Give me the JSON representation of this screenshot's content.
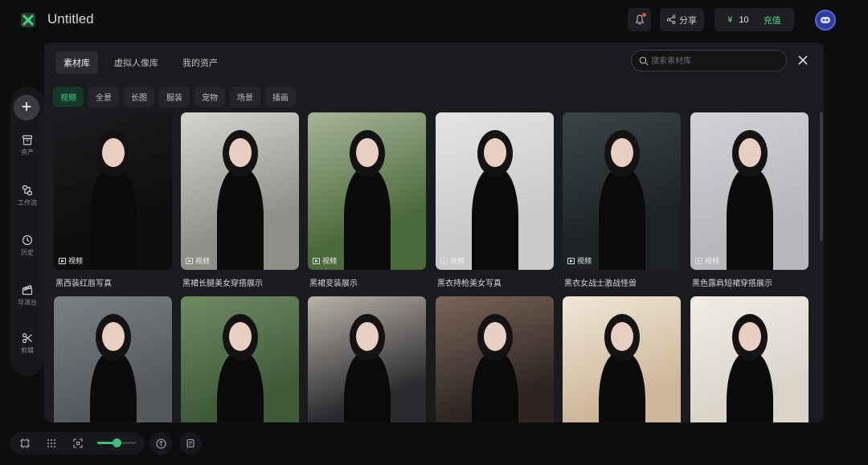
{
  "app": {
    "title": "Untitled"
  },
  "header": {
    "share_label": "分享",
    "credits_symbol": "¥",
    "credits_value": "10",
    "recharge_label": "充值"
  },
  "sidebar": {
    "add_label": "+",
    "items": [
      {
        "label": "资产",
        "icon": "archive-icon"
      },
      {
        "label": "工作流",
        "icon": "workflow-icon"
      },
      {
        "label": "历史",
        "icon": "clock-icon"
      },
      {
        "label": "导演台",
        "icon": "clapperboard-icon"
      },
      {
        "label": "剪辑",
        "icon": "scissors-icon"
      }
    ]
  },
  "bottombar": {
    "zoom_level": 0.5,
    "icons": [
      "frame-icon",
      "grid-icon",
      "fit-screen-icon",
      "help-icon",
      "notes-icon"
    ]
  },
  "modal": {
    "tabs": [
      {
        "label": "素材库",
        "active": true
      },
      {
        "label": "虚拟人像库",
        "active": false
      },
      {
        "label": "我的资产",
        "active": false
      }
    ],
    "search_placeholder": "搜索素材库",
    "filters": [
      {
        "label": "视频",
        "active": true
      },
      {
        "label": "全景",
        "active": false
      },
      {
        "label": "长图",
        "active": false
      },
      {
        "label": "服装",
        "active": false
      },
      {
        "label": "宠物",
        "active": false
      },
      {
        "label": "场景",
        "active": false
      },
      {
        "label": "插画",
        "active": false
      }
    ],
    "badge_label": "视频",
    "cards_row1": [
      {
        "title": "黑西装红唇写真",
        "bg": "#0e0c0d",
        "accent": "#1d1b1f"
      },
      {
        "title": "黑裙长腿美女穿搭展示",
        "bg": "#8f8f8a",
        "accent": "#d6d4cf"
      },
      {
        "title": "黑裙变装展示",
        "bg": "#4b6a3a",
        "accent": "#a7b59a"
      },
      {
        "title": "黑衣持枪美女写真",
        "bg": "#c9c9c9",
        "accent": "#e4e4e4"
      },
      {
        "title": "黑衣女战士激战怪兽",
        "bg": "#1c2224",
        "accent": "#3a4446"
      },
      {
        "title": "黑色露肩短裙穿搭展示",
        "bg": "#b9b7bc",
        "accent": "#d3d1d6"
      }
    ],
    "cards_row2": [
      {
        "bg": "#55595e",
        "accent": "#7b8086"
      },
      {
        "bg": "#3f5a39",
        "accent": "#6f8a63"
      },
      {
        "bg": "#2a2a2f",
        "accent": "#b9b3a8"
      },
      {
        "bg": "#2d2521",
        "accent": "#7a655a"
      },
      {
        "bg": "#cdb79a",
        "accent": "#f0e6d6"
      },
      {
        "bg": "#d9d3c8",
        "accent": "#f1ede5"
      }
    ]
  }
}
